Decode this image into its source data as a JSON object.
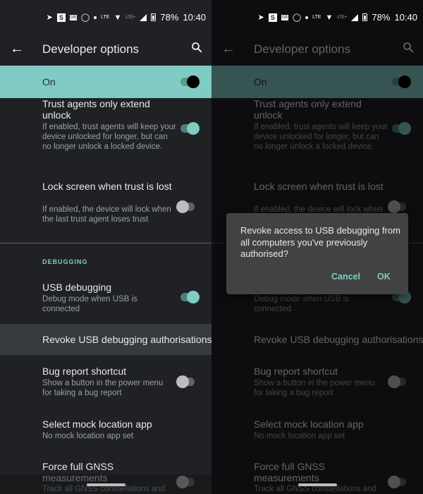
{
  "status_bar": {
    "notification_icons": [
      "telegram-icon",
      "s-app-icon",
      "gb-icon",
      "whatsapp-icon",
      "dot-icon"
    ],
    "volte_label": "LTE",
    "lte_plus_label": "LTE+",
    "battery_percent": "78%",
    "time": "10:40"
  },
  "toolbar": {
    "title": "Developer options",
    "back_icon": "arrow-back-icon",
    "search_icon": "search-icon"
  },
  "master_switch": {
    "label": "On",
    "state": true
  },
  "settings": {
    "trust_agents": {
      "title": "Trust agents only extend unlock",
      "summary": "If enabled, trust agents will keep your device unlocked for longer, but can no longer unlock a locked device.",
      "state": true
    },
    "lock_screen": {
      "title": "Lock screen when trust is lost",
      "summary": "If enabled, the device will lock when the last trust agent loses trust",
      "state": false
    },
    "section_debugging": "DEBUGGING",
    "usb_debugging": {
      "title": "USB debugging",
      "summary": "Debug mode when USB is connected",
      "state": true
    },
    "revoke": {
      "title": "Revoke USB debugging authorisations"
    },
    "bug_report": {
      "title": "Bug report shortcut",
      "summary": "Show a button in the power menu for taking a bug report",
      "state": false
    },
    "mock_location": {
      "title": "Select mock location app",
      "summary": "No mock location app set"
    },
    "gnss": {
      "title": "Force full GNSS measurements",
      "summary": "Track all GNSS constellations and",
      "state": false
    }
  },
  "dialog": {
    "message": "Revoke access to USB debugging from all computers you've previously authorised?",
    "cancel_label": "Cancel",
    "ok_label": "OK"
  },
  "colors": {
    "accent": "#80cbc4",
    "background": "#202124",
    "dialog_bg": "#424242"
  }
}
